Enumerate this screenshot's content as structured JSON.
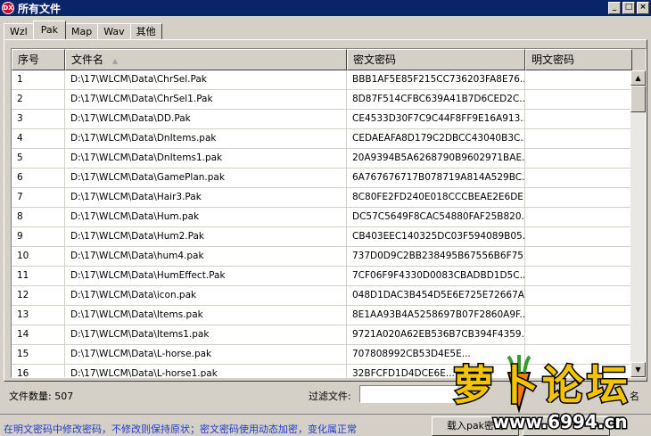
{
  "window": {
    "title": "所有文件",
    "icon_text": "DX",
    "minimize": "_",
    "maximize": "□",
    "close": "×"
  },
  "tabs": [
    {
      "label": "Wzl",
      "active": false
    },
    {
      "label": "Pak",
      "active": true
    },
    {
      "label": "Map",
      "active": false
    },
    {
      "label": "Wav",
      "active": false
    },
    {
      "label": "其他",
      "active": false
    }
  ],
  "grid": {
    "headers": [
      "序号",
      "文件名",
      "密文密码",
      "明文密码"
    ],
    "rows": [
      [
        "1",
        "D:\\17\\WLCM\\Data\\ChrSel.Pak",
        "BBB1AF5E85F215CC736203FA8E76...",
        ""
      ],
      [
        "2",
        "D:\\17\\WLCM\\Data\\ChrSel1.Pak",
        "8D87F514CFBC639A41B7D6CED2C...",
        ""
      ],
      [
        "3",
        "D:\\17\\WLCM\\Data\\DD.Pak",
        "CE4533D30F7C9C44F8FF9E16A913...",
        ""
      ],
      [
        "4",
        "D:\\17\\WLCM\\Data\\DnItems.pak",
        "CEDAEAFA8D179C2DBCC43040B3C...",
        ""
      ],
      [
        "5",
        "D:\\17\\WLCM\\Data\\DnItems1.pak",
        "20A9394B5A6268790B9602971BAE...",
        ""
      ],
      [
        "6",
        "D:\\17\\WLCM\\Data\\GamePlan.pak",
        "6A767676717B078719A814A529BC...",
        ""
      ],
      [
        "7",
        "D:\\17\\WLCM\\Data\\Hair3.Pak",
        "8C80FE2FD240E018CCCBEAE2E6DE...",
        ""
      ],
      [
        "8",
        "D:\\17\\WLCM\\Data\\Hum.pak",
        "DC57C5649F8CAC54880FAF25B820...",
        ""
      ],
      [
        "9",
        "D:\\17\\WLCM\\Data\\Hum2.Pak",
        "CB403EEC140325DC03F594089B05...",
        ""
      ],
      [
        "10",
        "D:\\17\\WLCM\\Data\\hum4.pak",
        "737D0D9C2BB238495B67556B6F75...",
        ""
      ],
      [
        "11",
        "D:\\17\\WLCM\\Data\\HumEffect.Pak",
        "7CF06F9F4330D0083CBADBD1D5C...",
        ""
      ],
      [
        "12",
        "D:\\17\\WLCM\\Data\\icon.pak",
        "048D1DAC3B454D5E6E725E72667A...",
        ""
      ],
      [
        "13",
        "D:\\17\\WLCM\\Data\\Items.pak",
        "8E1AA93B4A5258697B07F2860A9F...",
        ""
      ],
      [
        "14",
        "D:\\17\\WLCM\\Data\\Items1.pak",
        "9721A020A62EB536B7CB394F4359...",
        ""
      ],
      [
        "15",
        "D:\\17\\WLCM\\Data\\L-horse.pak",
        "707808992CB53D4E5E...",
        ""
      ],
      [
        "16",
        "D:\\17\\WLCM\\Data\\L-horse1.pak",
        "32BFCFD1D4DCE6E...",
        ""
      ]
    ]
  },
  "footer": {
    "file_count": "文件数量: 507",
    "filter_label": "过滤文件:",
    "filter_value": "",
    "right_label": "名"
  },
  "statusbar": {
    "hint": "在明文密码中修改密码，不修改则保持原状；密文密码使用动态加密，变化属正常",
    "load_button": "载入pak密码"
  },
  "watermark": {
    "brand": "萝卜论坛",
    "url": "www.6994.cn"
  }
}
